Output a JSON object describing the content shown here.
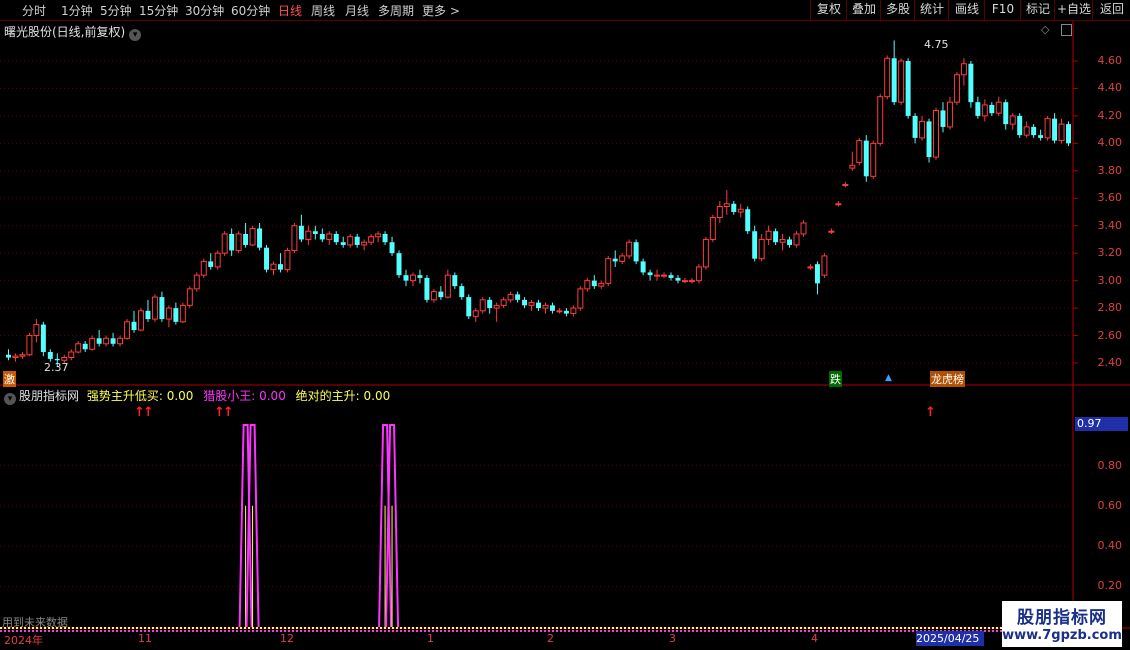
{
  "toolbar": {
    "timeframes": [
      "分时",
      "1分钟",
      "5分钟",
      "15分钟",
      "30分钟",
      "60分钟",
      "日线",
      "周线",
      "月线",
      "多周期",
      "更多"
    ],
    "active_timeframe": "日线",
    "buttons": [
      "复权",
      "叠加",
      "多股",
      "统计",
      "画线",
      "F10",
      "标记",
      "+自选",
      "返回"
    ]
  },
  "main_chart": {
    "title": "曙光股份(日线,前复权)",
    "y_ticks": [
      "4.60",
      "4.40",
      "4.20",
      "4.00",
      "3.80",
      "3.60",
      "3.40",
      "3.20",
      "3.00",
      "2.80",
      "2.60",
      "2.40"
    ],
    "high_label": "4.75",
    "low_label": "2.37",
    "signals": {
      "left": "激",
      "fall": "跌",
      "rank": "龙虎榜"
    }
  },
  "indicator": {
    "name": "股朋指标网",
    "line1_label": "强势主升低买: 0.00",
    "line2_label": "猎股小王: 0.00",
    "line3_label": "绝对的主升: 0.00",
    "y_ticks": [
      "0.80",
      "0.60",
      "0.40",
      "0.20"
    ],
    "current_value": "0.97",
    "footer_text": "用到未来数据"
  },
  "x_axis": {
    "labels": [
      "2024年",
      "11",
      "12",
      "1",
      "2",
      "3",
      "4"
    ],
    "cursor_date": "2025/04/25"
  },
  "watermark": {
    "title": "股朋指标网",
    "url": "www.7gpzb.com"
  },
  "colors": {
    "up": "#ff3c3c",
    "down": "#54ffff",
    "signal": "#ff33ff",
    "axis": "#b00000"
  },
  "chart_data": {
    "type": "candlestick",
    "candles": [
      [
        2.46,
        2.5,
        2.42,
        2.44
      ],
      [
        2.44,
        2.47,
        2.41,
        2.45
      ],
      [
        2.45,
        2.48,
        2.43,
        2.46
      ],
      [
        2.46,
        2.62,
        2.45,
        2.6
      ],
      [
        2.6,
        2.72,
        2.55,
        2.68
      ],
      [
        2.68,
        2.7,
        2.45,
        2.48
      ],
      [
        2.48,
        2.5,
        2.41,
        2.43
      ],
      [
        2.43,
        2.47,
        2.37,
        2.42
      ],
      [
        2.42,
        2.46,
        2.4,
        2.44
      ],
      [
        2.44,
        2.5,
        2.42,
        2.48
      ],
      [
        2.48,
        2.56,
        2.47,
        2.54
      ],
      [
        2.54,
        2.56,
        2.48,
        2.5
      ],
      [
        2.5,
        2.6,
        2.49,
        2.58
      ],
      [
        2.58,
        2.64,
        2.52,
        2.54
      ],
      [
        2.54,
        2.6,
        2.52,
        2.58
      ],
      [
        2.58,
        2.62,
        2.52,
        2.54
      ],
      [
        2.54,
        2.6,
        2.52,
        2.58
      ],
      [
        2.58,
        2.72,
        2.57,
        2.7
      ],
      [
        2.7,
        2.78,
        2.62,
        2.64
      ],
      [
        2.64,
        2.8,
        2.63,
        2.78
      ],
      [
        2.78,
        2.86,
        2.7,
        2.72
      ],
      [
        2.72,
        2.9,
        2.7,
        2.88
      ],
      [
        2.88,
        2.92,
        2.7,
        2.72
      ],
      [
        2.72,
        2.82,
        2.66,
        2.8
      ],
      [
        2.8,
        2.84,
        2.68,
        2.7
      ],
      [
        2.7,
        2.84,
        2.69,
        2.82
      ],
      [
        2.82,
        2.96,
        2.8,
        2.94
      ],
      [
        2.94,
        3.06,
        2.92,
        3.04
      ],
      [
        3.04,
        3.16,
        3.02,
        3.14
      ],
      [
        3.14,
        3.2,
        3.08,
        3.1
      ],
      [
        3.1,
        3.22,
        3.08,
        3.2
      ],
      [
        3.2,
        3.36,
        3.18,
        3.34
      ],
      [
        3.34,
        3.38,
        3.18,
        3.22
      ],
      [
        3.22,
        3.36,
        3.2,
        3.34
      ],
      [
        3.34,
        3.42,
        3.24,
        3.26
      ],
      [
        3.26,
        3.4,
        3.25,
        3.38
      ],
      [
        3.38,
        3.42,
        3.22,
        3.24
      ],
      [
        3.24,
        3.26,
        3.06,
        3.08
      ],
      [
        3.08,
        3.14,
        3.04,
        3.12
      ],
      [
        3.12,
        3.2,
        3.06,
        3.08
      ],
      [
        3.08,
        3.24,
        3.06,
        3.22
      ],
      [
        3.22,
        3.42,
        3.2,
        3.4
      ],
      [
        3.4,
        3.48,
        3.28,
        3.3
      ],
      [
        3.3,
        3.4,
        3.26,
        3.36
      ],
      [
        3.36,
        3.4,
        3.3,
        3.34
      ],
      [
        3.34,
        3.38,
        3.28,
        3.3
      ],
      [
        3.3,
        3.36,
        3.26,
        3.34
      ],
      [
        3.34,
        3.36,
        3.26,
        3.28
      ],
      [
        3.28,
        3.32,
        3.24,
        3.26
      ],
      [
        3.26,
        3.34,
        3.24,
        3.32
      ],
      [
        3.32,
        3.34,
        3.24,
        3.26
      ],
      [
        3.26,
        3.3,
        3.22,
        3.28
      ],
      [
        3.28,
        3.34,
        3.26,
        3.32
      ],
      [
        3.32,
        3.36,
        3.28,
        3.34
      ],
      [
        3.34,
        3.36,
        3.26,
        3.28
      ],
      [
        3.28,
        3.32,
        3.18,
        3.2
      ],
      [
        3.2,
        3.22,
        3.02,
        3.04
      ],
      [
        3.04,
        3.08,
        2.96,
        3.0
      ],
      [
        3.0,
        3.06,
        2.96,
        3.04
      ],
      [
        3.04,
        3.08,
        2.98,
        3.02
      ],
      [
        3.02,
        3.04,
        2.84,
        2.86
      ],
      [
        2.86,
        2.94,
        2.84,
        2.92
      ],
      [
        2.92,
        2.96,
        2.86,
        2.88
      ],
      [
        2.88,
        3.08,
        2.87,
        3.04
      ],
      [
        3.04,
        3.06,
        2.94,
        2.96
      ],
      [
        2.96,
        2.98,
        2.86,
        2.88
      ],
      [
        2.88,
        2.9,
        2.72,
        2.74
      ],
      [
        2.74,
        2.8,
        2.7,
        2.78
      ],
      [
        2.78,
        2.88,
        2.76,
        2.86
      ],
      [
        2.86,
        2.88,
        2.76,
        2.8
      ],
      [
        2.8,
        2.84,
        2.7,
        2.82
      ],
      [
        2.82,
        2.88,
        2.8,
        2.86
      ],
      [
        2.86,
        2.92,
        2.84,
        2.9
      ],
      [
        2.9,
        2.92,
        2.84,
        2.86
      ],
      [
        2.86,
        2.88,
        2.8,
        2.82
      ],
      [
        2.82,
        2.86,
        2.78,
        2.84
      ],
      [
        2.84,
        2.86,
        2.78,
        2.8
      ],
      [
        2.8,
        2.84,
        2.76,
        2.82
      ],
      [
        2.82,
        2.84,
        2.76,
        2.78
      ],
      [
        2.78,
        2.8,
        2.76,
        2.78
      ],
      [
        2.78,
        2.8,
        2.74,
        2.76
      ],
      [
        2.76,
        2.82,
        2.74,
        2.8
      ],
      [
        2.8,
        2.96,
        2.78,
        2.94
      ],
      [
        2.94,
        3.02,
        2.92,
        3.0
      ],
      [
        3.0,
        3.04,
        2.94,
        2.96
      ],
      [
        2.96,
        3.0,
        2.94,
        2.98
      ],
      [
        2.98,
        3.18,
        2.96,
        3.16
      ],
      [
        3.16,
        3.22,
        3.1,
        3.14
      ],
      [
        3.14,
        3.2,
        3.12,
        3.18
      ],
      [
        3.18,
        3.3,
        3.16,
        3.28
      ],
      [
        3.28,
        3.3,
        3.12,
        3.14
      ],
      [
        3.14,
        3.16,
        3.04,
        3.06
      ],
      [
        3.06,
        3.08,
        3.0,
        3.04
      ],
      [
        3.04,
        3.08,
        3.0,
        3.04
      ],
      [
        3.04,
        3.06,
        3.02,
        3.04
      ],
      [
        3.04,
        3.06,
        3.0,
        3.02
      ],
      [
        3.02,
        3.04,
        2.98,
        3.0
      ],
      [
        3.0,
        3.02,
        2.98,
        3.0
      ],
      [
        3.0,
        3.02,
        2.98,
        3.0
      ],
      [
        3.0,
        3.12,
        2.98,
        3.1
      ],
      [
        3.1,
        3.32,
        3.08,
        3.3
      ],
      [
        3.3,
        3.48,
        3.28,
        3.46
      ],
      [
        3.46,
        3.58,
        3.42,
        3.54
      ],
      [
        3.54,
        3.66,
        3.48,
        3.56
      ],
      [
        3.56,
        3.58,
        3.48,
        3.5
      ],
      [
        3.5,
        3.56,
        3.46,
        3.52
      ],
      [
        3.52,
        3.54,
        3.34,
        3.36
      ],
      [
        3.36,
        3.4,
        3.14,
        3.16
      ],
      [
        3.16,
        3.34,
        3.14,
        3.3
      ],
      [
        3.3,
        3.4,
        3.26,
        3.36
      ],
      [
        3.36,
        3.38,
        3.26,
        3.28
      ],
      [
        3.28,
        3.34,
        3.22,
        3.3
      ],
      [
        3.3,
        3.32,
        3.24,
        3.26
      ],
      [
        3.26,
        3.36,
        3.24,
        3.34
      ],
      [
        3.34,
        3.44,
        3.32,
        3.42
      ],
      [
        3.1,
        3.12,
        3.08,
        3.1
      ],
      [
        3.12,
        3.14,
        2.9,
        2.98
      ],
      [
        3.04,
        3.2,
        3.02,
        3.18
      ],
      [
        3.36,
        3.38,
        3.34,
        3.36
      ],
      [
        3.56,
        3.58,
        3.54,
        3.56
      ],
      [
        3.7,
        3.72,
        3.68,
        3.7
      ],
      [
        3.82,
        3.94,
        3.8,
        3.84
      ],
      [
        3.86,
        4.04,
        3.84,
        4.02
      ],
      [
        4.02,
        4.06,
        3.72,
        3.76
      ],
      [
        3.76,
        4.02,
        3.74,
        4.0
      ],
      [
        4.0,
        4.36,
        3.98,
        4.34
      ],
      [
        4.34,
        4.64,
        4.32,
        4.62
      ],
      [
        4.62,
        4.75,
        4.28,
        4.3
      ],
      [
        4.3,
        4.62,
        4.28,
        4.6
      ],
      [
        4.6,
        4.62,
        4.18,
        4.2
      ],
      [
        4.2,
        4.22,
        4.0,
        4.04
      ],
      [
        4.04,
        4.2,
        4.02,
        4.16
      ],
      [
        4.16,
        4.18,
        3.86,
        3.9
      ],
      [
        3.9,
        4.26,
        3.88,
        4.24
      ],
      [
        4.24,
        4.3,
        4.08,
        4.12
      ],
      [
        4.12,
        4.34,
        4.1,
        4.3
      ],
      [
        4.3,
        4.52,
        4.28,
        4.5
      ],
      [
        4.5,
        4.62,
        4.42,
        4.58
      ],
      [
        4.58,
        4.6,
        4.26,
        4.3
      ],
      [
        4.3,
        4.34,
        4.18,
        4.2
      ],
      [
        4.2,
        4.32,
        4.16,
        4.28
      ],
      [
        4.28,
        4.3,
        4.2,
        4.22
      ],
      [
        4.22,
        4.34,
        4.2,
        4.3
      ],
      [
        4.3,
        4.32,
        4.1,
        4.14
      ],
      [
        4.14,
        4.22,
        4.1,
        4.2
      ],
      [
        4.2,
        4.22,
        4.04,
        4.06
      ],
      [
        4.06,
        4.16,
        4.04,
        4.12
      ],
      [
        4.12,
        4.14,
        4.04,
        4.06
      ],
      [
        4.06,
        4.1,
        4.02,
        4.04
      ],
      [
        4.04,
        4.2,
        4.02,
        4.18
      ],
      [
        4.18,
        4.22,
        4.0,
        4.02
      ],
      [
        4.02,
        4.18,
        4.0,
        4.14
      ],
      [
        4.14,
        4.16,
        3.98,
        4.0
      ]
    ],
    "indicator_series": {
      "name": "猎股小王",
      "spikes": [
        [
          34,
          1.0
        ],
        [
          35,
          1.0
        ],
        [
          54,
          1.0
        ],
        [
          55,
          1.0
        ],
        [
          226,
          1.0
        ]
      ]
    },
    "y_range": [
      2.37,
      4.75
    ],
    "indicator_range": [
      0,
      1.0
    ]
  }
}
